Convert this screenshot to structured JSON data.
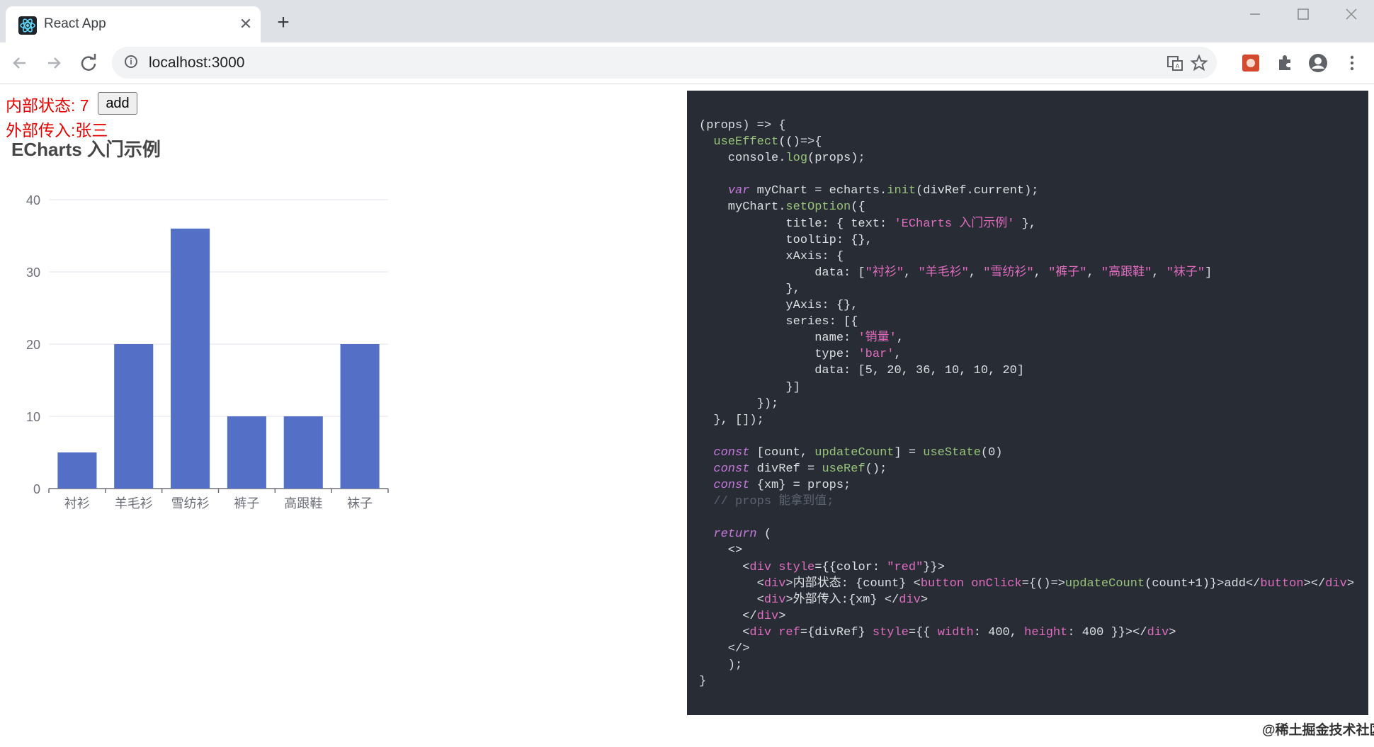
{
  "browser": {
    "tab_title": "React App",
    "url": "localhost:3000",
    "new_tab_label": "+",
    "close_label": "✕"
  },
  "page": {
    "count_label": "内部状态: 7",
    "add_button_label": "add",
    "xm_label": "外部传入:张三"
  },
  "chart_data": {
    "type": "bar",
    "title": "ECharts 入门示例",
    "categories": [
      "衬衫",
      "羊毛衫",
      "雪纺衫",
      "裤子",
      "高跟鞋",
      "袜子"
    ],
    "series": [
      {
        "values": [
          5,
          20,
          36,
          10,
          10,
          20
        ]
      }
    ],
    "ylim": [
      0,
      40
    ],
    "yticks": [
      0,
      10,
      20,
      30,
      40
    ],
    "grid": true,
    "bar_color": "#5470c6"
  },
  "code_panel": {
    "lines": [
      "(props) => {",
      "  useEffect(()=>{",
      "    console.log(props);",
      "",
      "    var myChart = echarts.init(divRef.current);",
      "    myChart.setOption({",
      "            title: { text: 'ECharts 入门示例' },",
      "            tooltip: {},",
      "            xAxis: {",
      "                data: [\"衬衫\", \"羊毛衫\", \"雪纺衫\", \"裤子\", \"高跟鞋\", \"袜子\"]",
      "            },",
      "            yAxis: {},",
      "            series: [{",
      "                name: '销量',",
      "                type: 'bar',",
      "                data: [5, 20, 36, 10, 10, 20]",
      "            }]",
      "        });",
      "  }, []);",
      "",
      "  const [count, updateCount] = useState(0)",
      "  const divRef = useRef();",
      "  const {xm} = props;",
      "  // props 能拿到值;",
      "",
      "  return (",
      "    <>",
      "      <div style={{color: \"red\"}}>",
      "        <div>内部状态: {count} <button onClick={()=>updateCount(count+1)}>add</button></div>",
      "        <div>外部传入:{xm} </div>",
      "      </div>",
      "      <div ref={divRef} style={{ width: 400, height: 400 }}></div>",
      "    </>",
      "    );",
      "}"
    ]
  },
  "watermark": "@稀土掘金技术社区",
  "colors": {
    "accent_red": "#e60000",
    "code_bg": "#282c34",
    "bar": "#5470c6"
  }
}
